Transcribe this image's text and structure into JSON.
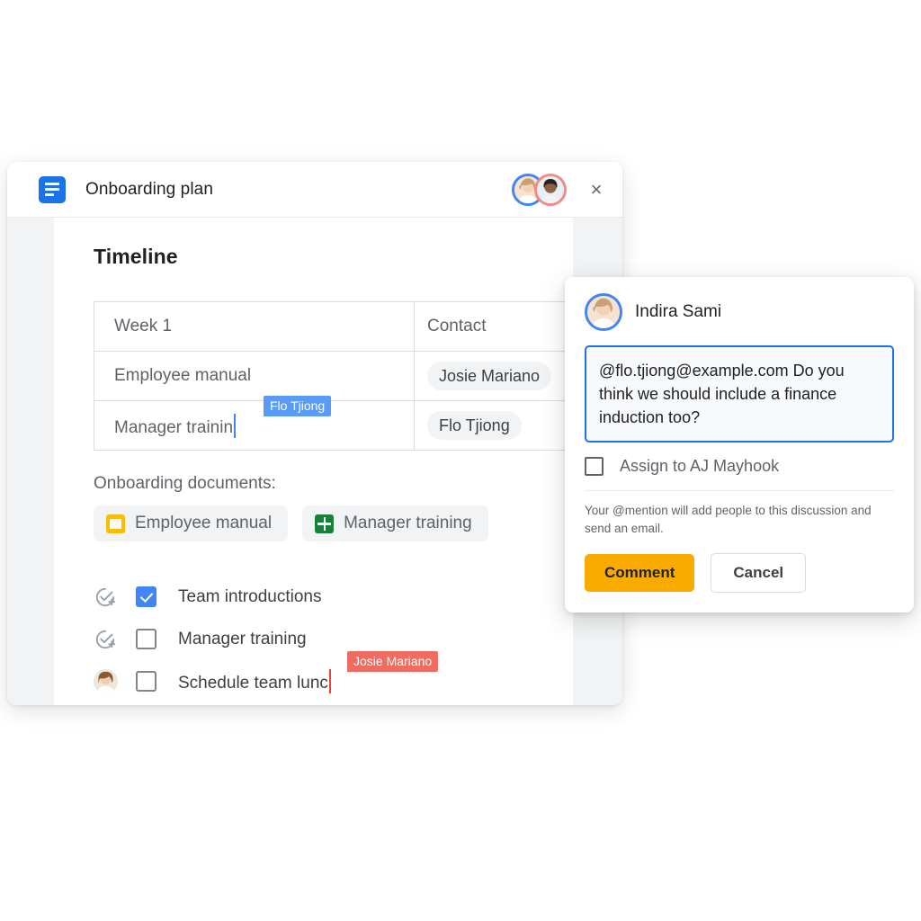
{
  "window": {
    "title": "Onboarding plan",
    "doc_icon": "google-docs-icon",
    "close_label": "×",
    "collaborators": [
      "Indira Sami",
      "AJ Mayhook"
    ]
  },
  "document": {
    "heading": "Timeline",
    "table": {
      "rows": [
        {
          "task": "Week 1",
          "contact": "Contact",
          "is_header": true
        },
        {
          "task": "Employee manual",
          "contact": "Josie Mariano",
          "is_header": false
        },
        {
          "task": "Manager trainin",
          "contact": "Flo Tjiong",
          "is_header": false
        }
      ]
    },
    "collab_cursor_table": {
      "name": "Flo Tjiong",
      "color": "#5b9bf8"
    },
    "documents_label": "Onboarding documents:",
    "document_chips": [
      {
        "label": "Employee manual",
        "icon": "slides-icon",
        "color": "#fbbc04"
      },
      {
        "label": "Manager training",
        "icon": "sheets-icon",
        "color": "#188038"
      }
    ],
    "checklist": [
      {
        "label": "Team introductions",
        "checked": true,
        "lead_icon": "add-task-icon"
      },
      {
        "label": "Manager training",
        "checked": false,
        "lead_icon": "add-task-icon"
      },
      {
        "label": "Schedule team lunc",
        "checked": false,
        "lead_icon": "assignee-avatar"
      }
    ],
    "collab_cursor_checklist": {
      "name": "Josie Mariano",
      "color": "#ee6c60"
    }
  },
  "comment_popup": {
    "author": "Indira Sami",
    "comment_text": "@flo.tjiong@example.com Do you think we should include a finance induction too?",
    "assign_label": "Assign to AJ Mayhook",
    "assign_checked": false,
    "hint": "Your @mention will add people to this discussion and send an email.",
    "submit_label": "Comment",
    "cancel_label": "Cancel",
    "submit_color": "#f9ab00"
  }
}
